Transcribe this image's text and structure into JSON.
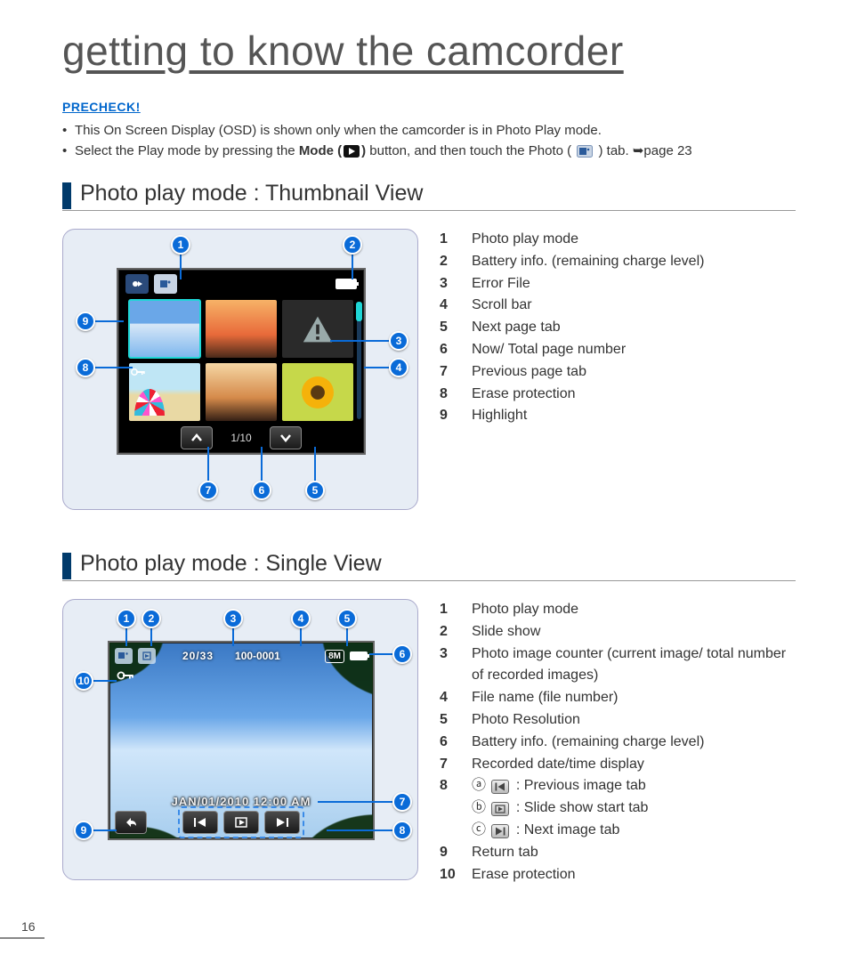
{
  "title": "getting to know the camcorder",
  "precheck": {
    "label": "PRECHECK!",
    "items": [
      {
        "pre": "This On Screen Display (OSD) is shown only when the camcorder is in Photo Play mode."
      },
      {
        "pre": "Select the Play mode by pressing the ",
        "bold": "Mode (",
        "boldIconAfter": ")",
        "post": " button, and then touch the Photo ( ",
        "tail": " ) tab. ➥page 23"
      }
    ]
  },
  "sections": {
    "thumbnail": {
      "heading": "Photo play mode : Thumbnail View",
      "pager": "1/10",
      "callouts": [
        "1",
        "2",
        "3",
        "4",
        "5",
        "6",
        "7",
        "8",
        "9"
      ],
      "legend": [
        {
          "n": "1",
          "t": "Photo play mode"
        },
        {
          "n": "2",
          "t": "Battery info. (remaining charge level)"
        },
        {
          "n": "3",
          "t": "Error File"
        },
        {
          "n": "4",
          "t": "Scroll bar"
        },
        {
          "n": "5",
          "t": "Next page tab"
        },
        {
          "n": "6",
          "t": "Now/ Total page number"
        },
        {
          "n": "7",
          "t": "Previous page tab"
        },
        {
          "n": "8",
          "t": "Erase protection"
        },
        {
          "n": "9",
          "t": "Highlight"
        }
      ]
    },
    "single": {
      "heading": "Photo play mode : Single View",
      "counter": "20/33",
      "filename": "100-0001",
      "resolution": "8M",
      "datetime": "JAN/01/2010 12:00 AM",
      "callouts": [
        "1",
        "2",
        "3",
        "4",
        "5",
        "6",
        "7",
        "8",
        "9",
        "10"
      ],
      "legend": [
        {
          "n": "1",
          "t": "Photo play mode"
        },
        {
          "n": "2",
          "t": "Slide show"
        },
        {
          "n": "3",
          "t": "Photo image counter (current image/ total number of recorded images)"
        },
        {
          "n": "4",
          "t": "File name (file number)"
        },
        {
          "n": "5",
          "t": "Photo Resolution"
        },
        {
          "n": "6",
          "t": "Battery info. (remaining charge level)"
        },
        {
          "n": "7",
          "t": "Recorded date/time display"
        }
      ],
      "legend8": {
        "n": "8",
        "a_label": "ⓐ",
        "a_text": " : Previous image tab",
        "b_label": "ⓑ",
        "b_text": " : Slide show start tab",
        "c_label": "ⓒ",
        "c_text": " : Next image tab"
      },
      "legend_tail": [
        {
          "n": "9",
          "t": "Return tab"
        },
        {
          "n": "10",
          "t": "Erase protection"
        }
      ]
    }
  },
  "pageNumber": "16"
}
